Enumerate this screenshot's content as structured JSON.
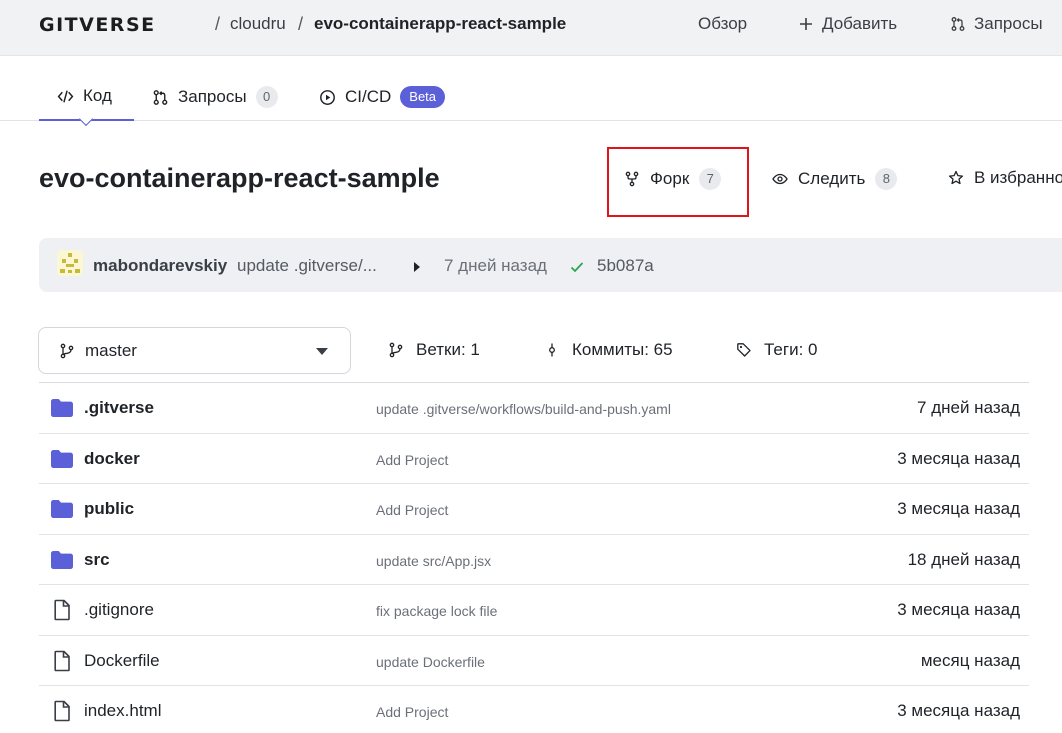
{
  "header": {
    "logo": "GITVERSE",
    "breadcrumb": [
      "cloudru",
      "evo-containerapp-react-sample"
    ],
    "nav": {
      "overview": "Обзор",
      "add": "Добавить",
      "requests": "Запросы"
    }
  },
  "tabs": {
    "code": "Код",
    "requests": "Запросы",
    "requests_count": "0",
    "cicd": "CI/CD",
    "cicd_badge": "Beta"
  },
  "repo": {
    "title": "evo-containerapp-react-sample",
    "fork_label": "Форк",
    "fork_count": "7",
    "watch_label": "Следить",
    "watch_count": "8",
    "star_label": "В избранное"
  },
  "last_commit": {
    "author": "mabondarevskiy",
    "message": "update .gitverse/...",
    "time": "7 дней назад",
    "hash": "5b087a"
  },
  "branch": {
    "selected": "master",
    "branches": "Ветки: 1",
    "commits": "Коммиты: 65",
    "tags": "Теги: 0"
  },
  "files": [
    {
      "name": ".gitverse",
      "type": "dir",
      "message": "update .gitverse/workflows/build-and-push.yaml",
      "date": "7 дней назад"
    },
    {
      "name": "docker",
      "type": "dir",
      "message": "Add Project",
      "date": "3 месяца назад"
    },
    {
      "name": "public",
      "type": "dir",
      "message": "Add Project",
      "date": "3 месяца назад"
    },
    {
      "name": "src",
      "type": "dir",
      "message": "update src/App.jsx",
      "date": "18 дней назад"
    },
    {
      "name": ".gitignore",
      "type": "file",
      "message": "fix package lock file",
      "date": "3 месяца назад"
    },
    {
      "name": "Dockerfile",
      "type": "file",
      "message": "update Dockerfile",
      "date": "месяц назад"
    },
    {
      "name": "index.html",
      "type": "file",
      "message": "Add Project",
      "date": "3 месяца назад"
    }
  ],
  "colors": {
    "accent": "#5b5fd8",
    "folder": "#5b5fd8",
    "highlight": "#e0141b",
    "check": "#2da44e"
  }
}
